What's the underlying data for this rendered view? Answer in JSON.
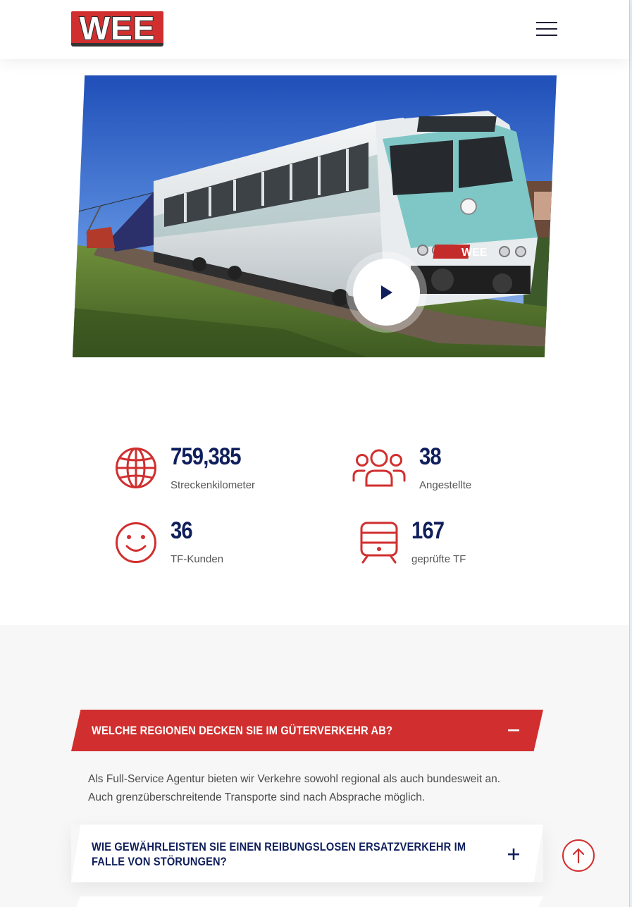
{
  "header": {
    "logo_text": "WEE",
    "menu_icon": "hamburger-menu-icon"
  },
  "video": {
    "play_icon": "play-icon",
    "train_badge": "WEE"
  },
  "stats": [
    {
      "icon": "globe-icon",
      "value": "759,385",
      "label": "Streckenkilometer"
    },
    {
      "icon": "users-icon",
      "value": "38",
      "label": "Angestellte"
    },
    {
      "icon": "smiley-icon",
      "value": "36",
      "label": "TF-Kunden"
    },
    {
      "icon": "train-icon",
      "value": "167",
      "label": "geprüfte TF"
    }
  ],
  "faq": {
    "items": [
      {
        "question": "Welche Regionen decken Sie im Güterverkehr ab?",
        "expanded": true,
        "answer": "Als Full-Service Agentur bieten wir Verkehre sowohl regional als auch bundesweit an. Auch grenzüberschreitende Transporte sind nach Absprache möglich."
      },
      {
        "question": "Wie gewährleisten Sie einen reibungslosen Ersatzverkehr im Falle von Störungen?",
        "expanded": false
      }
    ]
  },
  "back_to_top_icon": "arrow-up-icon",
  "colors": {
    "brand_red": "#d12f2f",
    "navy": "#0f1f5c"
  }
}
